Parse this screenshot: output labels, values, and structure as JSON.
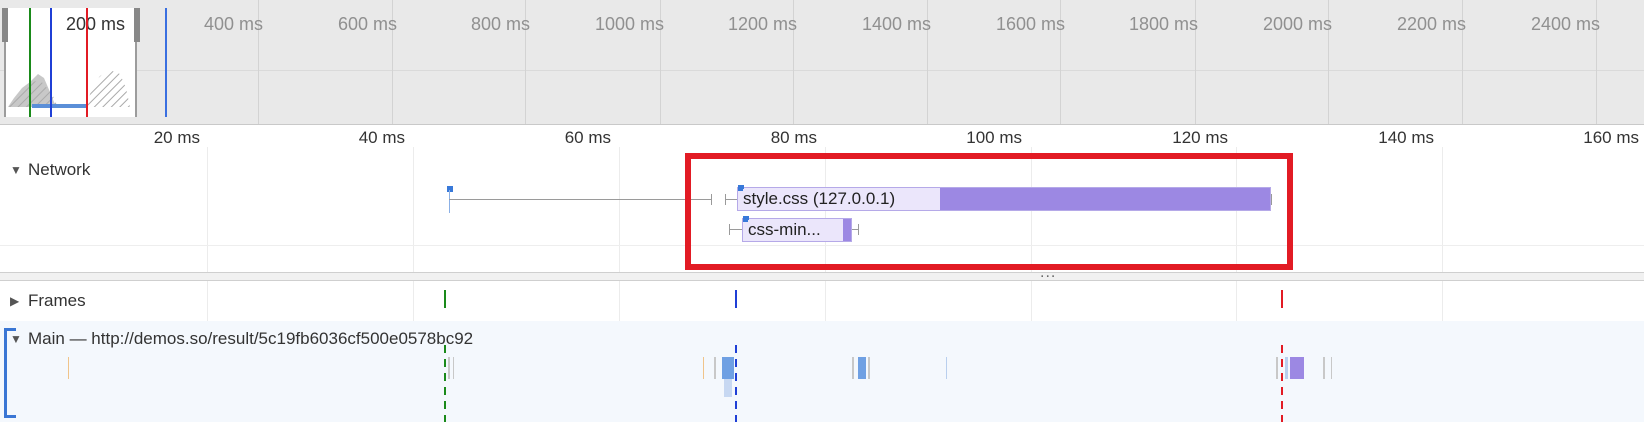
{
  "overview": {
    "window_label": "200 ms",
    "tick_labels": [
      "400 ms",
      "600 ms",
      "800 ms",
      "1000 ms",
      "1200 ms",
      "1400 ms",
      "1600 ms",
      "1800 ms",
      "2000 ms",
      "2200 ms",
      "2400 ms"
    ]
  },
  "ruler": {
    "tick_labels": [
      "20 ms",
      "40 ms",
      "60 ms",
      "80 ms",
      "100 ms",
      "120 ms",
      "140 ms",
      "160 ms"
    ]
  },
  "network": {
    "label": "Network",
    "requests": [
      {
        "name": "style.css (127.0.0.1)"
      },
      {
        "name": "css-min..."
      }
    ]
  },
  "splitter": {
    "dots": "..."
  },
  "frames": {
    "label": "Frames"
  },
  "main": {
    "label": "Main — http://demos.so/result/5c19fb6036cf500e0578bc92"
  },
  "icons": {
    "expanded": "triangle-down-icon",
    "collapsed": "triangle-right-icon"
  },
  "colors": {
    "dom_content_loaded": "#1a8a1a",
    "first_paint": "#1f3fd6",
    "load": "#e21b24",
    "highlight_box": "#e21b24",
    "request_fill": "#9c88e3",
    "script_blue": "#6fa0e3"
  }
}
